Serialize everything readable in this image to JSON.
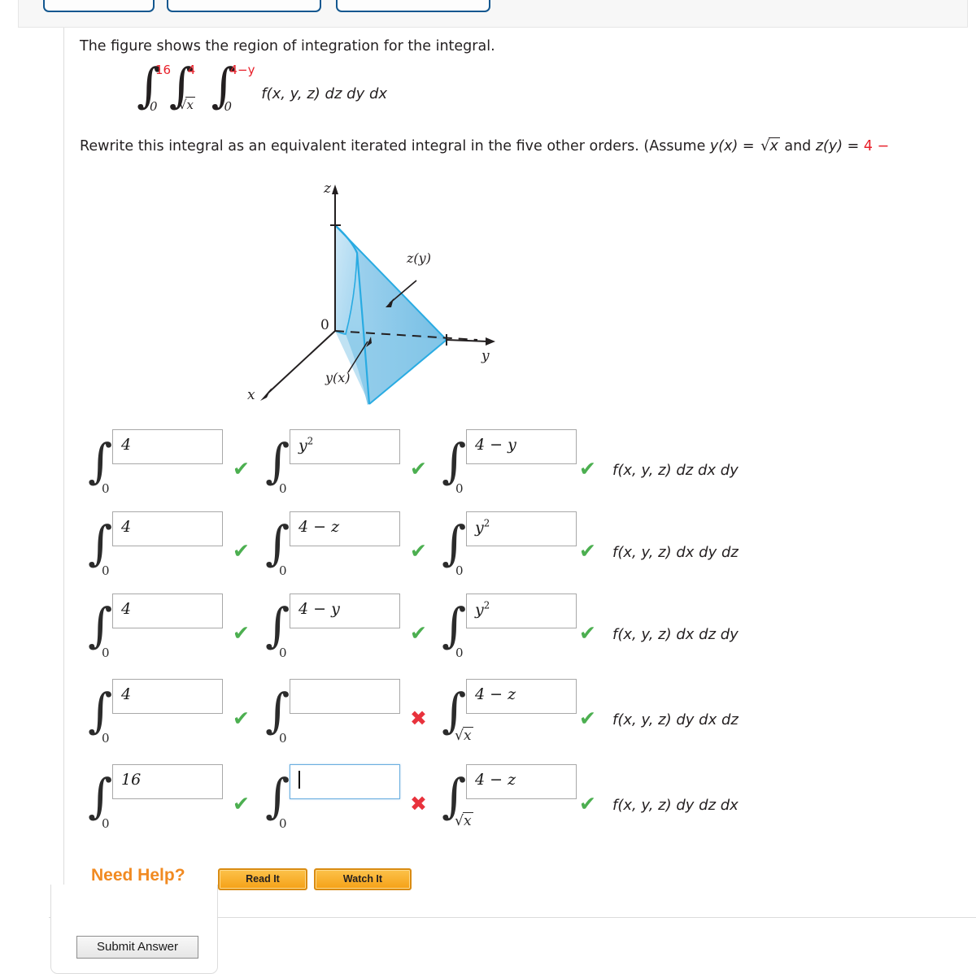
{
  "topbar": {
    "buttons": [
      {
        "name": "tab-button-1",
        "label": ""
      },
      {
        "name": "tab-button-2",
        "label": ""
      },
      {
        "name": "tab-button-3",
        "label": ""
      }
    ]
  },
  "prompt": {
    "line1": "The figure shows the region of integration for the integral.",
    "line2_a": "Rewrite this integral as an equivalent iterated integral in the five other orders. (Assume ",
    "line2_yx_lhs": "y(x) = ",
    "line2_yx_rhs": "x",
    "line2_and": " and ",
    "line2_zy_lhs": "z(y) = ",
    "line2_zy_rhs": "4 −"
  },
  "problem_integral": {
    "outer_upper": "16",
    "outer_lower": "0",
    "middle_upper": "4",
    "middle_lower_radicand": "x",
    "inner_upper": "4−y",
    "inner_lower": "0",
    "integrand": "f(x, y, z) dz dy dx"
  },
  "figure": {
    "axis_z": "z",
    "axis_y": "y",
    "axis_x": "x",
    "origin": "0",
    "label_zy": "z(y)",
    "label_yx": "y(x)"
  },
  "answer_rows": [
    {
      "order": "f(x, y, z) dz dx dy",
      "slots": [
        {
          "upper": "4",
          "upper_html": "4",
          "lower": "0",
          "lower_type": "plain",
          "mark": "check",
          "focused": false
        },
        {
          "upper": "y^2",
          "upper_html": "y<sup>2</sup>",
          "lower": "0",
          "lower_type": "plain",
          "mark": "check",
          "focused": false
        },
        {
          "upper": "4 − y",
          "upper_html": "4 − y",
          "lower": "0",
          "lower_type": "plain",
          "mark": "check",
          "focused": false
        }
      ]
    },
    {
      "order": "f(x, y, z) dx dy dz",
      "slots": [
        {
          "upper": "4",
          "upper_html": "4",
          "lower": "0",
          "lower_type": "plain",
          "mark": "check",
          "focused": false
        },
        {
          "upper": "4 − z",
          "upper_html": "4 − z",
          "lower": "0",
          "lower_type": "plain",
          "mark": "check",
          "focused": false
        },
        {
          "upper": "y^2",
          "upper_html": "y<sup>2</sup>",
          "lower": "0",
          "lower_type": "plain",
          "mark": "check",
          "focused": false
        }
      ]
    },
    {
      "order": "f(x, y, z) dx dz dy",
      "slots": [
        {
          "upper": "4",
          "upper_html": "4",
          "lower": "0",
          "lower_type": "plain",
          "mark": "check",
          "focused": false
        },
        {
          "upper": "4 − y",
          "upper_html": "4 − y",
          "lower": "0",
          "lower_type": "plain",
          "mark": "check",
          "focused": false
        },
        {
          "upper": "y^2",
          "upper_html": "y<sup>2</sup>",
          "lower": "0",
          "lower_type": "plain",
          "mark": "check",
          "focused": false
        }
      ]
    },
    {
      "order": "f(x, y, z) dy dx dz",
      "slots": [
        {
          "upper": "4",
          "upper_html": "4",
          "lower": "0",
          "lower_type": "plain",
          "mark": "check",
          "focused": false
        },
        {
          "upper": "",
          "upper_html": "",
          "lower": "0",
          "lower_type": "plain",
          "mark": "cross",
          "focused": false
        },
        {
          "upper": "4 − z",
          "upper_html": "4 − z",
          "lower": "x",
          "lower_type": "sqrt",
          "mark": "check",
          "focused": false
        }
      ]
    },
    {
      "order": "f(x, y, z) dy dz dx",
      "slots": [
        {
          "upper": "16",
          "upper_html": "16",
          "lower": "0",
          "lower_type": "plain",
          "mark": "check",
          "focused": false
        },
        {
          "upper": "",
          "upper_html": "",
          "lower": "0",
          "lower_type": "plain",
          "mark": "cross",
          "focused": true
        },
        {
          "upper": "4 − z",
          "upper_html": "4 − z",
          "lower": "x",
          "lower_type": "sqrt",
          "mark": "check",
          "focused": false
        }
      ]
    }
  ],
  "marks": {
    "check": "✔",
    "cross": "✖"
  },
  "help": {
    "label": "Need Help?",
    "read_it": "Read It",
    "watch_it": "Watch It"
  },
  "submit": {
    "label": "Submit Answer"
  },
  "colors": {
    "red_limit": "#e8202a",
    "check_green": "#4caf50",
    "cross_red": "#e8323c",
    "help_orange": "#f18a21",
    "figure_blue": "#29abe2",
    "tab_border_blue": "#13578f"
  }
}
